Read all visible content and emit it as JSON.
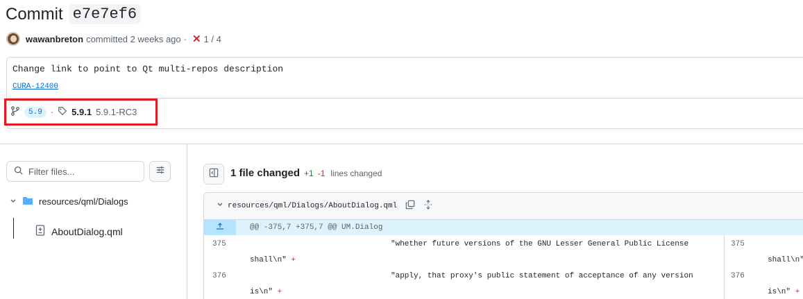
{
  "header": {
    "title_prefix": "Commit",
    "sha": "e7e7ef6"
  },
  "meta": {
    "author": "wawanbreton",
    "action": "committed 2 weeks ago",
    "dot": "·",
    "status_icon": "x-icon",
    "checks": "1 / 4"
  },
  "message": {
    "text": "Change link to point to Qt multi-repos description",
    "link": "CURA-12400"
  },
  "refs": {
    "branch": "5.9",
    "dot": "·",
    "tag_main": "5.9.1",
    "tag_sub": "5.9.1-RC3"
  },
  "sidebar": {
    "filter_placeholder": "Filter files...",
    "folder": "resources/qml/Dialogs",
    "file": "AboutDialog.qml"
  },
  "diff": {
    "files_changed": "1 file changed",
    "additions": "+1",
    "deletions": "-1",
    "lines_changed": "lines changed",
    "file_path": "resources/qml/Dialogs/AboutDialog.qml",
    "hunk": "@@ -375,7 +375,7 @@ UM.Dialog",
    "lines": [
      {
        "num": "375",
        "text": "\"whether future versions of the GNU Lesser General Public License",
        "cont": "shall\\n\"",
        "right_num": "375",
        "right_cont": "shall\\n\""
      },
      {
        "num": "376",
        "text": "\"apply, that proxy's public statement of acceptance of any version",
        "cont": "is\\n\"",
        "right_num": "376",
        "right_cont": "is\\n\""
      }
    ],
    "plus": "+"
  },
  "colors": {
    "accent": "#0969da",
    "danger": "#d1242f",
    "success": "#1a7f37",
    "highlight_box": "#e01b24"
  }
}
